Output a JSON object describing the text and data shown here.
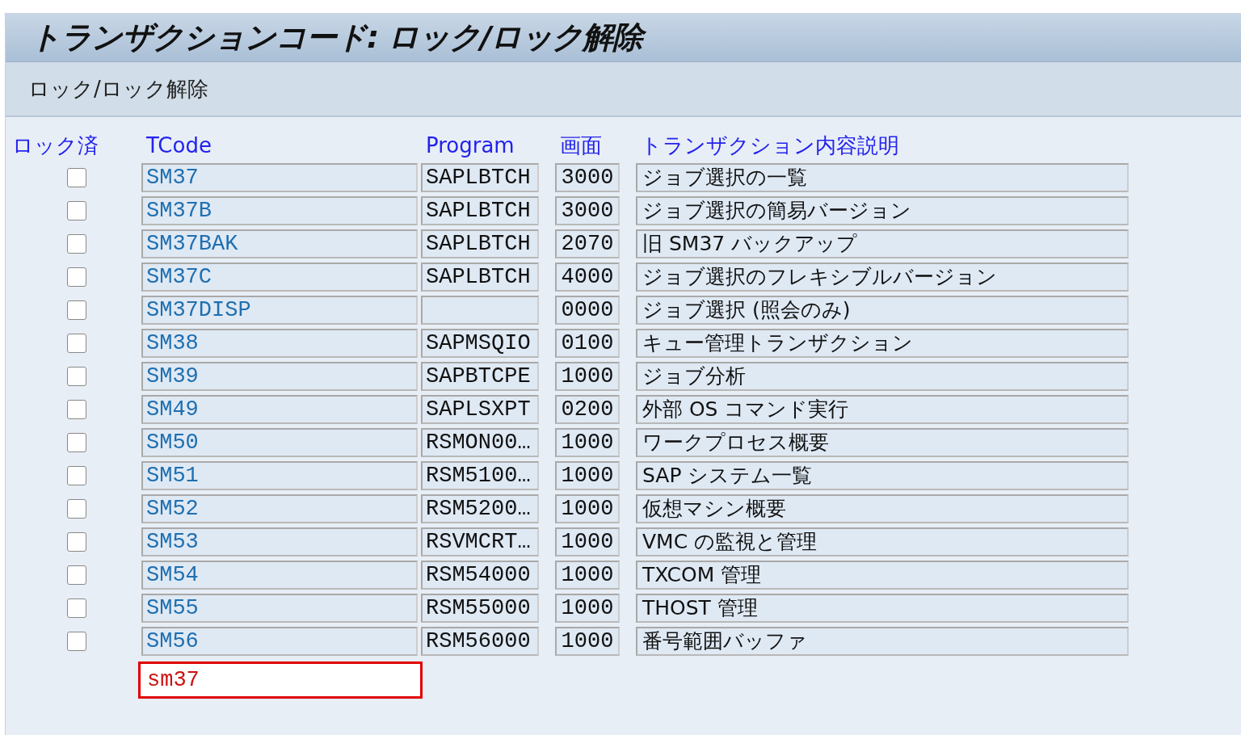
{
  "window": {
    "title": "トランザクションコード: ロック/ロック解除"
  },
  "toolbar": {
    "label": "ロック/ロック解除"
  },
  "table": {
    "columns": [
      "ロック済",
      "TCode",
      "Program",
      "画面",
      "トランザクション内容説明"
    ],
    "rows": [
      {
        "locked": false,
        "tcode": "SM37",
        "program": "SAPLBTCH",
        "screen": "3000",
        "description": "ジョブ選択の一覧"
      },
      {
        "locked": false,
        "tcode": "SM37B",
        "program": "SAPLBTCH",
        "screen": "3000",
        "description": "ジョブ選択の簡易バージョン"
      },
      {
        "locked": false,
        "tcode": "SM37BAK",
        "program": "SAPLBTCH",
        "screen": "2070",
        "description": "旧 SM37 バックアップ"
      },
      {
        "locked": false,
        "tcode": "SM37C",
        "program": "SAPLBTCH",
        "screen": "4000",
        "description": "ジョブ選択のフレキシブルバージョン"
      },
      {
        "locked": false,
        "tcode": "SM37DISP",
        "screen": "0000",
        "description": "ジョブ選択 (照会のみ)"
      },
      {
        "locked": false,
        "tcode": "SM38",
        "program": "SAPMSQIO",
        "screen": "0100",
        "description": "キュー管理トランザクション"
      },
      {
        "locked": false,
        "tcode": "SM39",
        "program": "SAPBTCPE",
        "screen": "1000",
        "description": "ジョブ分析"
      },
      {
        "locked": false,
        "tcode": "SM49",
        "program": "SAPLSXPT",
        "screen": "0200",
        "description": "外部 OS コマンド実行"
      },
      {
        "locked": false,
        "tcode": "SM50",
        "program": "RSMON00…",
        "screen": "1000",
        "description": "ワークプロセス概要"
      },
      {
        "locked": false,
        "tcode": "SM51",
        "program": "RSM5100…",
        "screen": "1000",
        "description": "SAP システム一覧"
      },
      {
        "locked": false,
        "tcode": "SM52",
        "program": "RSM5200…",
        "screen": "1000",
        "description": "仮想マシン概要"
      },
      {
        "locked": false,
        "tcode": "SM53",
        "program": "RSVMCRT…",
        "screen": "1000",
        "description": "VMC の監視と管理"
      },
      {
        "locked": false,
        "tcode": "SM54",
        "program": "RSM54000",
        "screen": "1000",
        "description": "TXCOM 管理"
      },
      {
        "locked": false,
        "tcode": "SM55",
        "program": "RSM55000",
        "screen": "1000",
        "description": "THOST 管理"
      },
      {
        "locked": false,
        "tcode": "SM56",
        "program": "RSM56000",
        "screen": "1000",
        "description": "番号範囲バッファ"
      }
    ]
  },
  "input": {
    "value": "sm37",
    "highlighted": true
  }
}
